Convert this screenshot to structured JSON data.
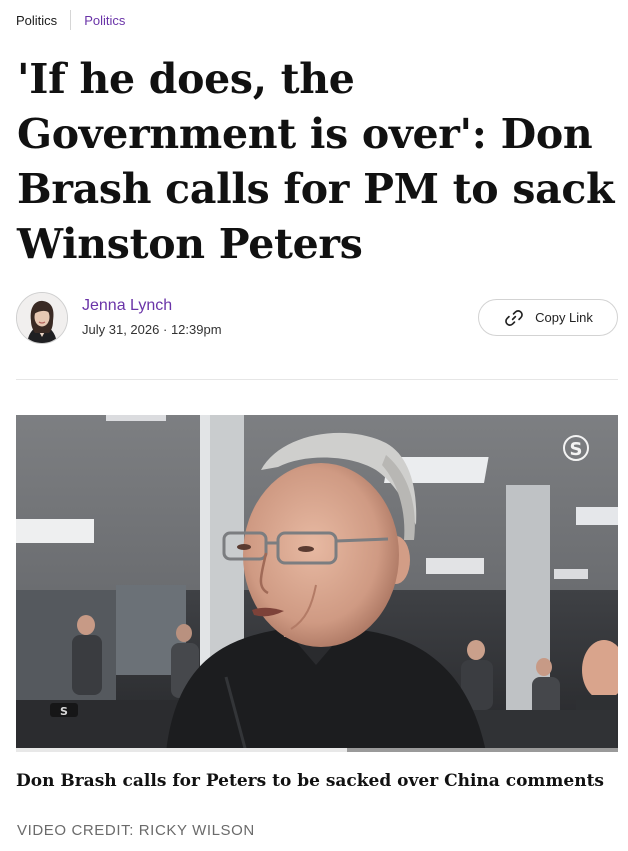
{
  "breadcrumb": {
    "primary": "Politics",
    "secondary": "Politics"
  },
  "article": {
    "headline": "'If he does, the Government is over': Don Brash calls for PM to sack Winston Peters"
  },
  "byline": {
    "author": "Jenna Lynch",
    "date": "July 31, 2026",
    "separator": "·",
    "time": "12:39pm",
    "copy_link_label": "Copy Link"
  },
  "video": {
    "channel_logo": "S",
    "watermark_logo": "S",
    "progress_percent": 55,
    "caption": "Don Brash calls for Peters to be sacked over China comments",
    "credit": "VIDEO CREDIT: RICKY WILSON"
  },
  "colors": {
    "accent": "#6a34a8",
    "text": "#111111",
    "muted": "#6b6b6b"
  },
  "icons": {
    "copy": "link-icon",
    "avatar": "author-avatar"
  }
}
